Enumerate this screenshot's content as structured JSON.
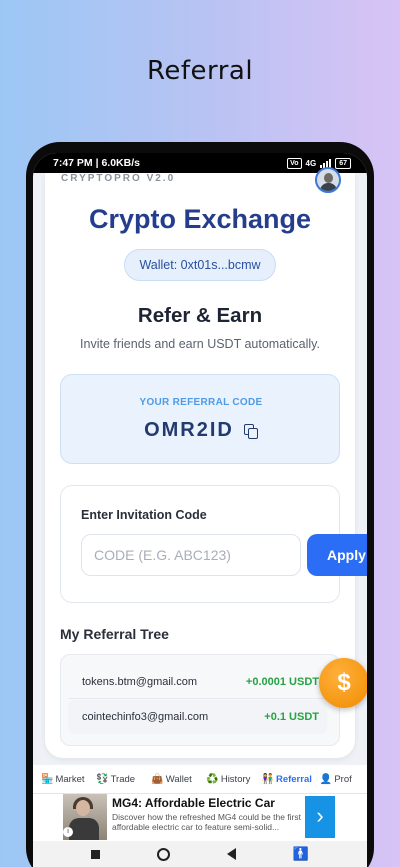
{
  "promo": {
    "title": "Referral"
  },
  "status_bar": {
    "time": "7:47 PM | 6.0KB/s",
    "network": "4G",
    "battery": "67"
  },
  "header": {
    "brand": "CRYPTOPRO V2.0",
    "app_title": "Crypto Exchange",
    "wallet": "Wallet: 0xt01s...bcmw"
  },
  "refer": {
    "title": "Refer & Earn",
    "subtitle": "Invite friends and earn USDT automatically."
  },
  "referral_code": {
    "label": "YOUR REFERRAL CODE",
    "code": "OMR2ID"
  },
  "invitation": {
    "label": "Enter Invitation Code",
    "placeholder": "CODE (E.G. ABC123)",
    "value": "",
    "apply_label": "Apply"
  },
  "tree": {
    "title": "My Referral Tree",
    "rows": [
      {
        "email": "tokens.btm@gmail.com",
        "amount": "+0.0001 USDT"
      },
      {
        "email": "cointechinfo3@gmail.com",
        "amount": "+0.1 USDT"
      }
    ]
  },
  "fab": {
    "symbol": "$"
  },
  "nav": {
    "items": [
      {
        "icon": "🏪",
        "label": "Market"
      },
      {
        "icon": "💱",
        "label": "Trade"
      },
      {
        "icon": "👜",
        "label": "Wallet"
      },
      {
        "icon": "♻️",
        "label": "History"
      },
      {
        "icon": "👫",
        "label": "Referral"
      },
      {
        "icon": "👤",
        "label": "Prof"
      }
    ],
    "active": "Referral"
  },
  "ad": {
    "title": "MG4: Affordable Electric Car",
    "description": "Discover how the refreshed MG4 could be the first affordable electric car to feature semi-solid...",
    "info": "i",
    "arrow": "›"
  },
  "colors": {
    "accent": "#2b6ef5",
    "title": "#243d8c",
    "positive": "#27a243",
    "fab": "#f08a00"
  }
}
